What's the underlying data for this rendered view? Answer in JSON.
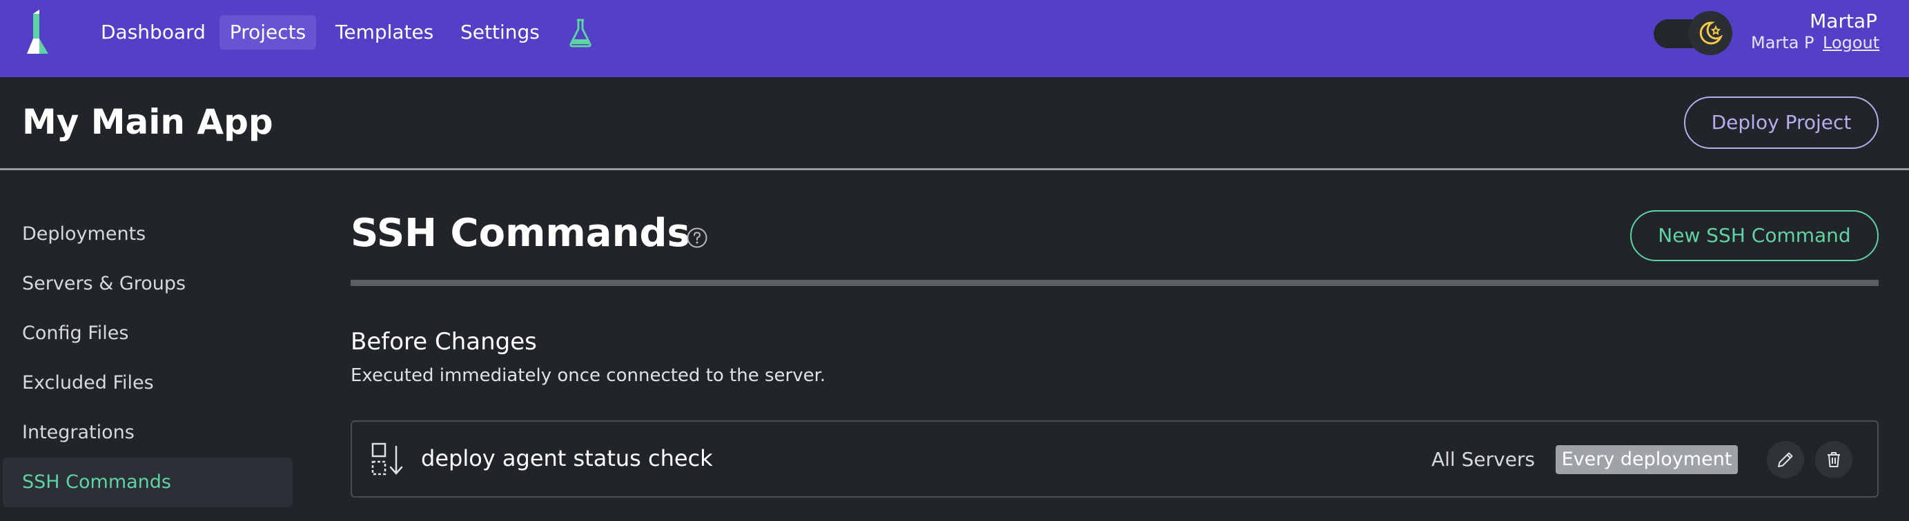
{
  "nav": {
    "logo_icon": "brand-logo-icon",
    "items": [
      {
        "label": "Dashboard"
      },
      {
        "label": "Projects",
        "active": true
      },
      {
        "label": "Templates"
      },
      {
        "label": "Settings"
      }
    ],
    "labs_icon": "flask-icon",
    "theme_toggle_icon": "moon-star-icon",
    "user": {
      "username": "MartaP",
      "full_name": "Marta P",
      "logout_label": "Logout"
    }
  },
  "project": {
    "title": "My Main App",
    "deploy_label": "Deploy Project"
  },
  "sidebar": {
    "items": [
      {
        "label": "Deployments"
      },
      {
        "label": "Servers & Groups"
      },
      {
        "label": "Config Files"
      },
      {
        "label": "Excluded Files"
      },
      {
        "label": "Integrations"
      },
      {
        "label": "SSH Commands",
        "active": true
      }
    ]
  },
  "main": {
    "title": "SSH Commands",
    "help_icon": "question-circle-icon",
    "new_button_label": "New SSH Command",
    "section": {
      "title": "Before Changes",
      "description": "Executed immediately once connected to the server."
    },
    "commands": [
      {
        "icon": "before-changes-icon",
        "name": "deploy agent status check",
        "servers": "All Servers",
        "frequency": "Every deployment",
        "edit_icon": "pencil-icon",
        "delete_icon": "trash-icon"
      }
    ]
  },
  "colors": {
    "topbar": "#5340c7",
    "background": "#212529",
    "accent_green": "#5fd3a3",
    "accent_purple": "#b6acee"
  }
}
